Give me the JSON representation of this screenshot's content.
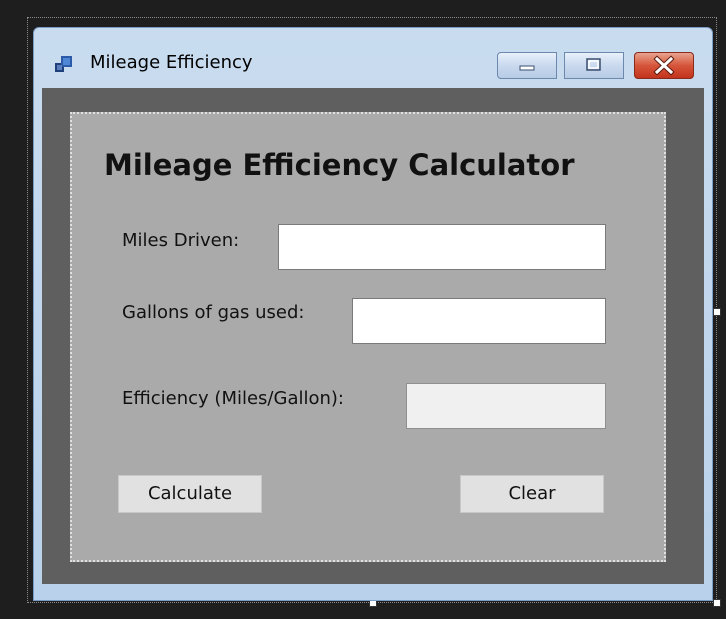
{
  "window": {
    "title": "Mileage Efficiency",
    "icon": "winforms-app-icon",
    "caption_buttons": [
      "minimize-icon",
      "maximize-icon",
      "close-icon"
    ]
  },
  "form": {
    "heading": "Mileage Efficiency Calculator",
    "fields": {
      "miles_label": "Miles Driven:",
      "miles_value": "",
      "gallons_label": "Gallons of gas used:",
      "gallons_value": "",
      "efficiency_label": "Efficiency (Miles/Gallon):",
      "efficiency_value": ""
    },
    "buttons": {
      "calculate": "Calculate",
      "clear": "Clear"
    }
  },
  "colors": {
    "client_background": "#5f5f5f",
    "panel_background": "#aaaaaa",
    "close_button": "#c9452c"
  }
}
